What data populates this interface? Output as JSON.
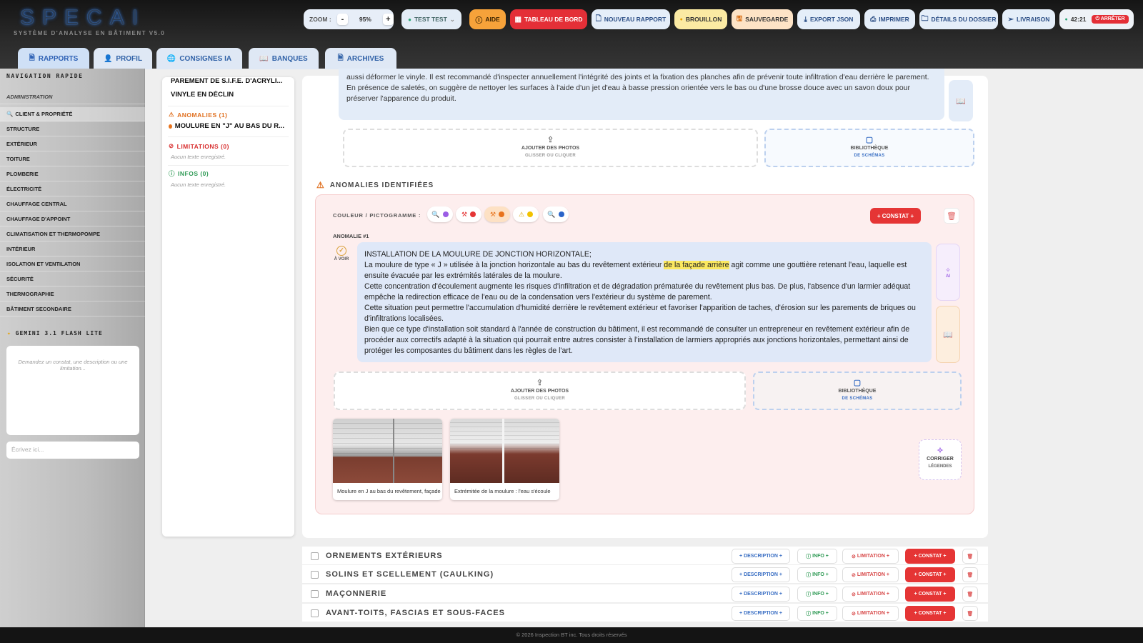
{
  "app": {
    "logo": "SPECAI",
    "subtitle": "SYSTÈME D'ANALYSE EN BÂTIMENT V5.0"
  },
  "toolbar": {
    "zoom_label": "ZOOM :",
    "zoom_minus": "-",
    "zoom_value": "95%",
    "zoom_plus": "+",
    "user_select": "TEST TEST",
    "help": "AIDE",
    "dashboard": "TABLEAU DE BORD",
    "new_report": "NOUVEAU RAPPORT",
    "draft": "BROUILLON",
    "save": "SAUVEGARDE",
    "export_json": "EXPORT JSON",
    "print": "IMPRIMER",
    "folder_details": "DÉTAILS DU DOSSIER",
    "delivery": "LIVRAISON",
    "timer": "42:21",
    "stop": "ARRÊTER"
  },
  "tabs": [
    {
      "label": "RAPPORTS",
      "icon": "document-icon"
    },
    {
      "label": "PROFIL",
      "icon": "user-icon"
    },
    {
      "label": "CONSIGNES IA",
      "icon": "globe-icon"
    },
    {
      "label": "BANQUES",
      "icon": "book-icon"
    },
    {
      "label": "ARCHIVES",
      "icon": "archive-icon"
    }
  ],
  "sidebar": {
    "title": "NAVIGATION RAPIDE",
    "items": [
      {
        "label": "ADMINISTRATION"
      },
      {
        "label": "CLIENT & PROPRIÉTÉ"
      },
      {
        "label": "STRUCTURE"
      },
      {
        "label": "EXTÉRIEUR"
      },
      {
        "label": "TOITURE"
      },
      {
        "label": "PLOMBERIE"
      },
      {
        "label": "ÉLECTRICITÉ"
      },
      {
        "label": "CHAUFFAGE CENTRAL"
      },
      {
        "label": "CHAUFFAGE D'APPOINT"
      },
      {
        "label": "CLIMATISATION ET THERMOPOMPE"
      },
      {
        "label": "INTÉRIEUR"
      },
      {
        "label": "ISOLATION ET VENTILATION"
      },
      {
        "label": "SÉCURITÉ"
      },
      {
        "label": "THERMOGRAPHIE"
      },
      {
        "label": "BÂTIMENT SECONDAIRE"
      }
    ],
    "ai_title": "GEMINI 3.1 FLASH LITE",
    "ai_placeholder": "Demandez un constat, une description ou une limitation...",
    "ai_input_placeholder": "Écrivez ici..."
  },
  "summary": {
    "line1": "PAREMENT DE S.I.F.E. D'ACRYLI...",
    "line2": "VINYLE EN DÉCLIN",
    "anomalies_head": "ANOMALIES (1)",
    "anomaly_item": "MOULURE EN \"J\" AU BAS DU R...",
    "limitations_head": "LIMITATIONS (0)",
    "limitations_empty": "Aucun texte enregistré.",
    "infos_head": "INFOS (0)",
    "infos_empty": "Aucun texte enregistré."
  },
  "prev_text": "aussi déformer le vinyle. Il est recommandé d'inspecter annuellement l'intégrité des joints et la fixation des planches afin de prévenir toute infiltration d'eau derrière le parement. En présence de saletés, on suggère de nettoyer les surfaces à l'aide d'un jet d'eau à basse pression orientée vers le bas ou d'une brosse douce avec un savon doux pour préserver l'apparence du produit.",
  "upload": {
    "label": "AJOUTER DES PHOTOS",
    "sub": "GLISSER OU CLIQUER"
  },
  "library": {
    "label": "BIBLIOTHÈQUE",
    "sub": "DE SCHÉMAS"
  },
  "anomalies": {
    "title": "ANOMALIES IDENTIFIÉES",
    "picker_label": "COULEUR / PICTOGRAMME :",
    "constat_btn": "+ CONSTAT +",
    "number": "ANOMALIE #1",
    "status": "À VOIR",
    "text_l1": "INSTALLATION DE LA MOULURE DE JONCTION HORIZONTALE;",
    "text_l2a": "La moulure de type « J » utilisée à la jonction horizontale au bas du revêtement extérieur ",
    "text_l2hl": "de la façade arrière",
    "text_l2b": " agit comme une gouttière retenant l'eau, laquelle est ensuite évacuée par les extrémités latérales de la moulure.",
    "text_l3": "Cette concentration d'écoulement augmente les risques d'infiltration et de dégradation prématurée du revêtement plus bas. De plus, l'absence d'un larmier adéquat empêche la redirection efficace de l'eau ou de la condensation vers l'extérieur du système de parement.",
    "text_l4": "Cette situation peut permettre l'accumulation d'humidité derrière le revêtement extérieur et favoriser l'apparition de taches, d'érosion sur les parements de briques ou d'infiltrations localisées.",
    "text_l5": "Bien que ce type d'installation soit standard à l'année de construction du bâtiment, il est recommandé de consulter un entrepreneur en revêtement extérieur afin de procéder aux correctifs adapté à la situation qui pourrait entre autres consister à l'installation de larmiers appropriés aux jonctions horizontales, permettant ainsi de protéger les composantes du bâtiment dans les règles de l'art.",
    "ai_label": "AI",
    "photos": [
      {
        "caption": "Moulure en J au bas du revêtement, façade arrière"
      },
      {
        "caption": "Extrémitée de la moulure : l'eau s'écoule"
      }
    ],
    "fix_label": "CORRIGER",
    "fix_sub": "LÉGENDES"
  },
  "rows": [
    {
      "label": "ORNEMENTS EXTÉRIEURS"
    },
    {
      "label": "SOLINS ET SCELLEMENT (CAULKING)"
    },
    {
      "label": "MAÇONNERIE"
    },
    {
      "label": "AVANT-TOITS, FASCIAS ET SOUS-FACES"
    }
  ],
  "row_buttons": {
    "description": "+ DESCRIPTION +",
    "info": "INFO +",
    "limitation": "LIMITATION +",
    "constat": "+ CONSTAT +"
  },
  "footer": "© 2026 Inspection BT inc. Tous droits réservés",
  "colors": {
    "accent": "#e53535",
    "primary": "#2e61b5",
    "anomaly_bg": "#fdeeee"
  }
}
